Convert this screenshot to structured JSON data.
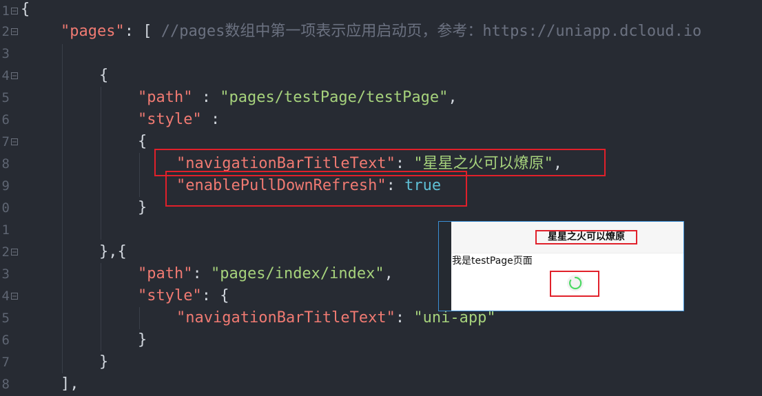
{
  "editor": {
    "line_numbers": [
      "1",
      "2",
      "3",
      "4",
      "5",
      "6",
      "7",
      "8",
      "9",
      "0",
      "1",
      "2",
      "3",
      "4",
      "5",
      "6",
      "7",
      "8"
    ],
    "code": {
      "l1_open": "{",
      "l2_key": "\"pages\"",
      "l2_punct": ": [ ",
      "l2_comment": "//pages数组中第一项表示应用启动页，参考：https://uniapp.dcloud.io",
      "l4_open": "{",
      "l5_key": "\"path\"",
      "l5_sep": " : ",
      "l5_val": "\"pages/testPage/testPage\"",
      "l5_end": ",",
      "l6_key": "\"style\"",
      "l6_sep": " :",
      "l7_open": "{",
      "l8_key": "\"navigationBarTitleText\"",
      "l8_sep": ": ",
      "l8_val": "\"星星之火可以燎原\"",
      "l8_end": ",",
      "l9_key": "\"enablePullDownRefresh\"",
      "l9_sep": ": ",
      "l9_val": "true",
      "l10_close": "}",
      "l12_close": "},{",
      "l13_key": "\"path\"",
      "l13_sep": ": ",
      "l13_val": "\"pages/index/index\"",
      "l13_end": ",",
      "l14_key": "\"style\"",
      "l14_sep": ": {",
      "l15_key": "\"navigationBarTitleText\"",
      "l15_sep": ": ",
      "l15_val": "\"uni-app\"",
      "l16_close": "}",
      "l17_close": "}",
      "l18_close": "],"
    }
  },
  "preview": {
    "nav_title": "星星之火可以燎原",
    "body_text": "我是testPage页面",
    "spinner_color": "#4cd964"
  },
  "colors": {
    "background": "#272b33",
    "highlight": "#e1202a",
    "key": "#f07a72",
    "string": "#a6d27c",
    "boolean": "#5fc0d6"
  }
}
